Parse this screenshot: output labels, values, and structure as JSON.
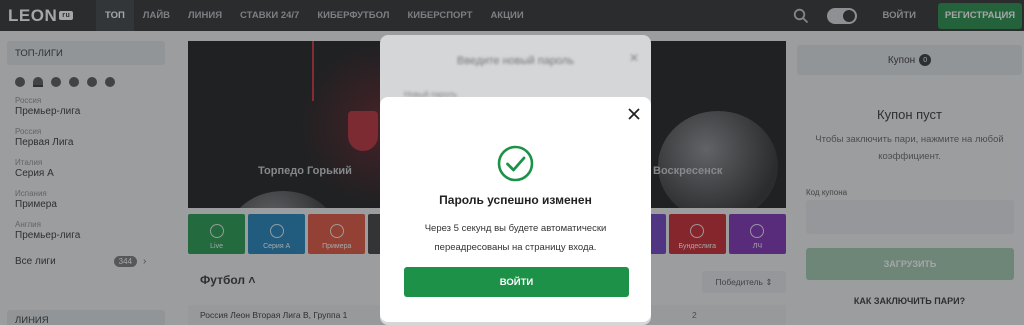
{
  "header": {
    "logo_text": "LEON",
    "logo_badge": "ru",
    "nav": [
      "ТОП",
      "ЛАЙВ",
      "ЛИНИЯ",
      "СТАВКИ 24/7",
      "КИБЕРФУТБОЛ",
      "КИБЕРСПОРТ",
      "АКЦИИ"
    ],
    "active_nav": "ТОП",
    "login": "ВОЙТИ",
    "register": "РЕГИСТРАЦИЯ"
  },
  "sidebar": {
    "top_leagues_title": "ТОП-ЛИГИ",
    "leagues": [
      {
        "country": "Россия",
        "name": "Премьер-лига"
      },
      {
        "country": "Россия",
        "name": "Первая Лига"
      },
      {
        "country": "Италия",
        "name": "Серия А"
      },
      {
        "country": "Испания",
        "name": "Примера"
      },
      {
        "country": "Англия",
        "name": "Премьер-лига"
      }
    ],
    "all_leagues": "Все лиги",
    "all_leagues_count": "344",
    "line_title": "ЛИНИЯ"
  },
  "banner": {
    "team_left": "Торпедо Горький",
    "team_right": "Воскресенск"
  },
  "tiles": [
    {
      "label": "Live",
      "color": "#1f9a4a"
    },
    {
      "label": "Серия А",
      "color": "#1d80b8"
    },
    {
      "label": "Примера",
      "color": "#e0513c"
    },
    {
      "label": "",
      "color": "#3c3c3c"
    },
    {
      "label": "",
      "color": "#3c3c3c"
    },
    {
      "label": "",
      "color": "#3c3c3c"
    },
    {
      "label": "",
      "color": "#3c3c3c"
    },
    {
      "label": "",
      "color": "#6d3fbf"
    },
    {
      "label": "Бундеслига",
      "color": "#c8242e"
    },
    {
      "label": "ЛЧ",
      "color": "#7a2bb4"
    }
  ],
  "main": {
    "section_title": "Футбол",
    "winner_select": "Победитель",
    "match": "Россия Леон Вторая Лига B, Группа 1",
    "match_value": "2"
  },
  "coupon": {
    "tab_label": "Купон",
    "tab_count": "0",
    "empty_title": "Купон пуст",
    "empty_hint": "Чтобы заключить пари, нажмите на любой коэффициент.",
    "code_label": "Код купона",
    "load_button": "ЗАГРУЗИТЬ",
    "how_to": "КАК ЗАКЛЮЧИТЬ ПАРИ?"
  },
  "background_modal": {
    "title": "Введите новый пароль",
    "field_label": "Новый пароль"
  },
  "modal": {
    "title": "Пароль успешно изменен",
    "message": "Через 5 секунд вы будете автоматически переадресованы на страницу входа.",
    "button": "ВОЙТИ",
    "accent": "#1e9149"
  }
}
